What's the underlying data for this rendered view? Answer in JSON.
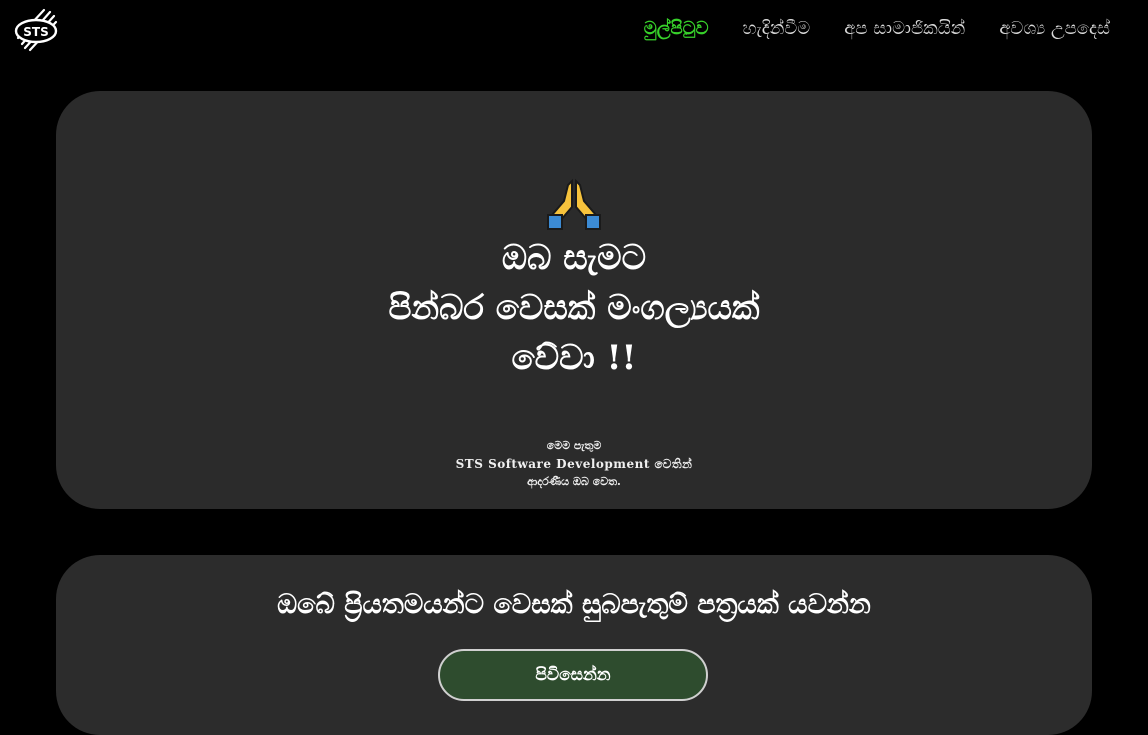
{
  "logo": {
    "text": "STS"
  },
  "nav": {
    "items": [
      {
        "label": "මුල්පිටුව",
        "active": true
      },
      {
        "label": "හැදින්වීම",
        "active": false
      },
      {
        "label": "අප සාමාජිකයින්",
        "active": false
      },
      {
        "label": "අවශ්‍ය උපදෙස්",
        "active": false
      }
    ]
  },
  "hero": {
    "icon": "folded-hands-icon",
    "line1": "ඔබ සැමට",
    "line2": "පින්බර වෙසක් මංගල්‍යයක්",
    "line3": "වේවා !!",
    "credit_line1": "මෙම පැතුම",
    "credit_line2": "STS Software Development වෙතින්",
    "credit_line3": "ආදරණීය ඔබ වෙත."
  },
  "send": {
    "title": "ඔබේ ප්‍රියතමයන්ට වෙසක් සුබපැතුම් පත්‍රයක් යවන්න",
    "button_label": "පිවිසෙන්න"
  },
  "colors": {
    "background": "#000000",
    "card": "#2b2b2b",
    "nav_active": "#37d12a",
    "button_bg": "#2e4c2e"
  }
}
